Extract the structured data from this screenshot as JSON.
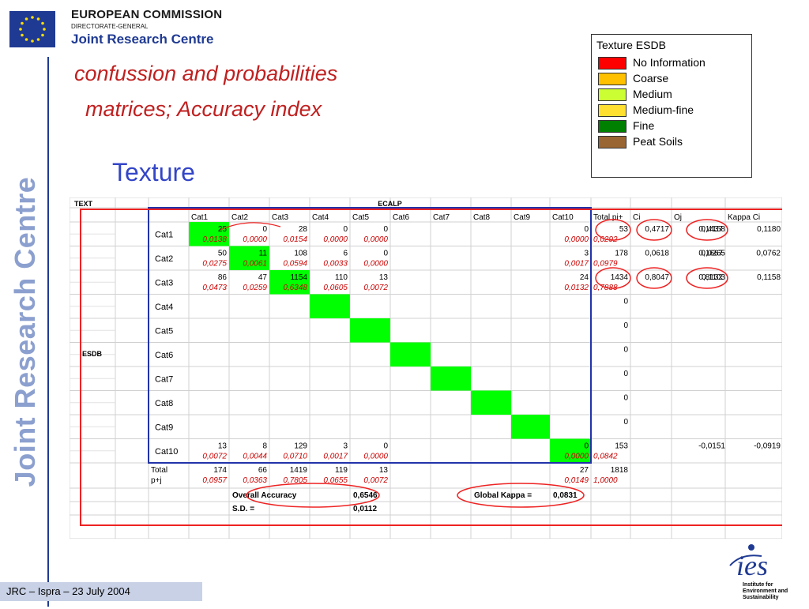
{
  "header": {
    "org_line1": "EUROPEAN COMMISSION",
    "org_line2": "DIRECTORATE-GENERAL",
    "org_line3": "Joint Research Centre"
  },
  "vertical_label": "Joint Research Centre",
  "title_line1": "confussion and probabilities",
  "title_line2": "matrices; Accuracy index",
  "subtitle": "Texture",
  "legend": {
    "title": "Texture ESDB",
    "items": [
      {
        "label": "No Information",
        "color": "#ff0000"
      },
      {
        "label": "Coarse",
        "color": "#ffc000"
      },
      {
        "label": "Medium",
        "color": "#ccff33"
      },
      {
        "label": "Medium-fine",
        "color": "#ffe030"
      },
      {
        "label": "Fine",
        "color": "#008000"
      },
      {
        "label": "Peat Soils",
        "color": "#996633"
      }
    ]
  },
  "table": {
    "corner": "TEXT",
    "top_header": "ECALP",
    "left_header": "ESDB",
    "columns": [
      "Cat1",
      "Cat2",
      "Cat3",
      "Cat4",
      "Cat5",
      "Cat6",
      "Cat7",
      "Cat8",
      "Cat9",
      "Cat10",
      "Total pi+",
      "Ci",
      "Oj",
      "Kappa Ci",
      "Kappa Oj"
    ],
    "rows": [
      {
        "label": "Cat1",
        "diag": 0,
        "counts": [
          "25",
          "0",
          "28",
          "0",
          "0",
          "",
          "",
          "",
          "",
          "0"
        ],
        "probs": [
          "0,0138",
          "0,0000",
          "0,0154",
          "0,0000",
          "0,0000",
          "",
          "",
          "",
          "",
          "0,0000"
        ],
        "total": "53",
        "total_p": "0,0292",
        "ci": "0,4717",
        "oj": "0,1437",
        "kci": "0,4158",
        "koj": "0,1180"
      },
      {
        "label": "Cat2",
        "diag": 1,
        "counts": [
          "50",
          "11",
          "108",
          "6",
          "0",
          "",
          "",
          "",
          "",
          "3"
        ],
        "probs": [
          "0,0275",
          "0,0061",
          "0,0594",
          "0,0033",
          "0,0000",
          "",
          "",
          "",
          "",
          "0,0017"
        ],
        "total": "178",
        "total_p": "0,0979",
        "ci": "0,0618",
        "oj": "0,1667",
        "kci": "0,0265",
        "koj": "0,0762"
      },
      {
        "label": "Cat3",
        "diag": 2,
        "counts": [
          "86",
          "47",
          "1154",
          "110",
          "13",
          "",
          "",
          "",
          "",
          "24"
        ],
        "probs": [
          "0,0473",
          "0,0259",
          "0,6348",
          "0,0605",
          "0,0072",
          "",
          "",
          "",
          "",
          "0,0132"
        ],
        "total": "1434",
        "total_p": "0,7888",
        "ci": "0,8047",
        "oj": "0,8132",
        "kci": "0,1103",
        "koj": "0,1158"
      },
      {
        "label": "Cat4",
        "diag": 3,
        "counts": [
          "",
          "",
          "",
          "",
          "",
          "",
          "",
          "",
          "",
          ""
        ],
        "probs": [
          "",
          "",
          "",
          "",
          "",
          "",
          "",
          "",
          "",
          ""
        ],
        "total": "0",
        "total_p": "",
        "ci": "",
        "oj": "",
        "kci": "",
        "koj": ""
      },
      {
        "label": "Cat5",
        "diag": 4,
        "counts": [
          "",
          "",
          "",
          "",
          "",
          "",
          "",
          "",
          "",
          ""
        ],
        "probs": [
          "",
          "",
          "",
          "",
          "",
          "",
          "",
          "",
          "",
          ""
        ],
        "total": "0",
        "total_p": "",
        "ci": "",
        "oj": "",
        "kci": "",
        "koj": ""
      },
      {
        "label": "Cat6",
        "diag": 5,
        "counts": [
          "",
          "",
          "",
          "",
          "",
          "",
          "",
          "",
          "",
          ""
        ],
        "probs": [
          "",
          "",
          "",
          "",
          "",
          "",
          "",
          "",
          "",
          ""
        ],
        "total": "0",
        "total_p": "",
        "ci": "",
        "oj": "",
        "kci": "",
        "koj": ""
      },
      {
        "label": "Cat7",
        "diag": 6,
        "counts": [
          "",
          "",
          "",
          "",
          "",
          "",
          "",
          "",
          "",
          ""
        ],
        "probs": [
          "",
          "",
          "",
          "",
          "",
          "",
          "",
          "",
          "",
          ""
        ],
        "total": "0",
        "total_p": "",
        "ci": "",
        "oj": "",
        "kci": "",
        "koj": ""
      },
      {
        "label": "Cat8",
        "diag": 7,
        "counts": [
          "",
          "",
          "",
          "",
          "",
          "",
          "",
          "",
          "",
          ""
        ],
        "probs": [
          "",
          "",
          "",
          "",
          "",
          "",
          "",
          "",
          "",
          ""
        ],
        "total": "0",
        "total_p": "",
        "ci": "",
        "oj": "",
        "kci": "",
        "koj": ""
      },
      {
        "label": "Cat9",
        "diag": 8,
        "counts": [
          "",
          "",
          "",
          "",
          "",
          "",
          "",
          "",
          "",
          ""
        ],
        "probs": [
          "",
          "",
          "",
          "",
          "",
          "",
          "",
          "",
          "",
          ""
        ],
        "total": "0",
        "total_p": "",
        "ci": "",
        "oj": "",
        "kci": "",
        "koj": ""
      },
      {
        "label": "Cat10",
        "diag": 9,
        "counts": [
          "13",
          "8",
          "129",
          "3",
          "0",
          "",
          "",
          "",
          "",
          "0"
        ],
        "probs": [
          "0,0072",
          "0,0044",
          "0,0710",
          "0,0017",
          "0,0000",
          "",
          "",
          "",
          "",
          "0,0000"
        ],
        "total": "153",
        "total_p": "0,0842",
        "ci": "",
        "oj": "",
        "kci": "-0,0151",
        "koj": "-0,0919"
      }
    ],
    "total_row": {
      "label1": "Total",
      "label2": "p+j",
      "counts": [
        "174",
        "66",
        "1419",
        "119",
        "13",
        "",
        "",
        "",
        "",
        "27"
      ],
      "probs": [
        "0,0957",
        "0,0363",
        "0,7805",
        "0,0655",
        "0,0072",
        "",
        "",
        "",
        "",
        "0,0149"
      ],
      "grand_total": "1818",
      "grand_p": "1,0000"
    },
    "overall_accuracy_label": "Overall Accuracy",
    "overall_accuracy": "0,6546",
    "sd_label": "S.D. =",
    "sd": "0,0112",
    "global_kappa_label": "Global Kappa =",
    "global_kappa": "0,0831"
  },
  "footer": "JRC – Ispra – 23 July 2004",
  "ies_logo": {
    "text": "ies",
    "line1": "Institute for",
    "line2": "Environment and",
    "line3": "Sustainability"
  },
  "colors": {
    "diag_green": "#00ff00",
    "red_text": "#cc0000",
    "blue_frame": "#2233aa",
    "red_frame": "#ee2222"
  }
}
